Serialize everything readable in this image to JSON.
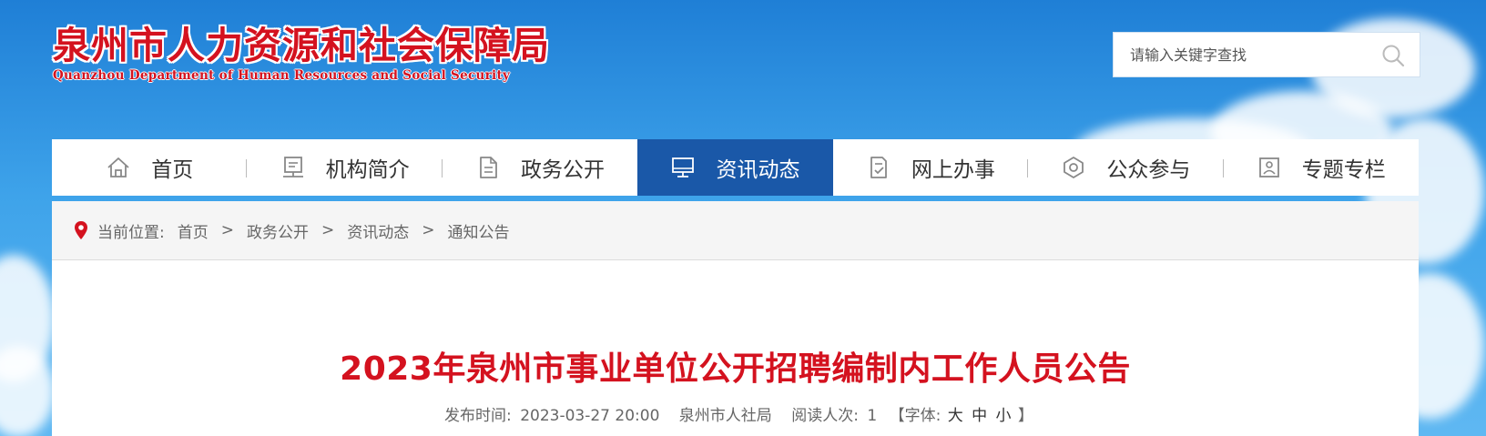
{
  "site": {
    "name_cn": "泉州市人力资源和社会保障局",
    "name_en": "Quanzhou Department of Human Resources and Social Security"
  },
  "search": {
    "placeholder": "请输入关键字查找",
    "icon": "search-icon"
  },
  "nav": {
    "items": [
      {
        "label": "首页",
        "icon": "home-icon"
      },
      {
        "label": "机构简介",
        "icon": "organization-icon"
      },
      {
        "label": "政务公开",
        "icon": "document-icon"
      },
      {
        "label": "资讯动态",
        "icon": "monitor-icon"
      },
      {
        "label": "网上办事",
        "icon": "checklist-icon"
      },
      {
        "label": "公众参与",
        "icon": "participation-icon"
      },
      {
        "label": "专题专栏",
        "icon": "column-icon"
      }
    ],
    "active_index": 3
  },
  "breadcrumb": {
    "label": "当前位置:",
    "items": [
      "首页",
      "政务公开",
      "资讯动态",
      "通知公告"
    ],
    "separator": ">"
  },
  "article": {
    "title": "2023年泉州市事业单位公开招聘编制内工作人员公告",
    "publish_label": "发布时间:",
    "publish_time": "2023-03-27 20:00",
    "source": "泉州市人社局",
    "reads_label": "阅读人次:",
    "reads": "1",
    "font_label_open": "【字体:",
    "font_large": "大",
    "font_medium": "中",
    "font_small": "小",
    "font_label_close": "】"
  },
  "colors": {
    "brand_red": "#d4121f",
    "nav_active": "#1a58a8"
  }
}
